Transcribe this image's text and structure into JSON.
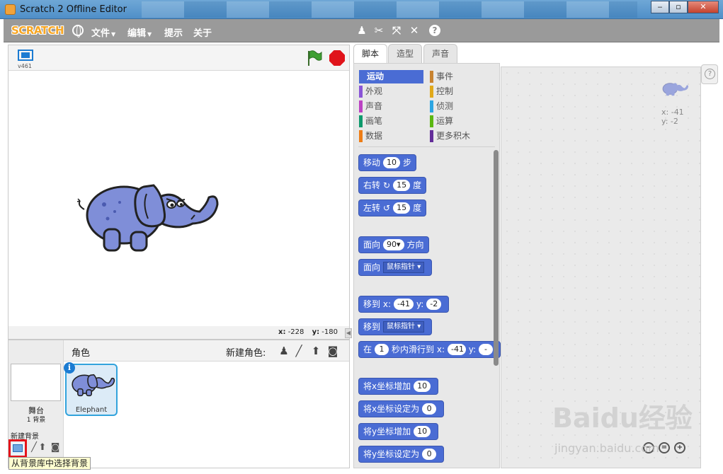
{
  "window": {
    "title": "Scratch 2 Offline Editor",
    "buttons": [
      "‒",
      "▫",
      "✕"
    ]
  },
  "menubar": {
    "logo": "SCRATCH",
    "items": [
      {
        "label": "文件",
        "has_caret": true
      },
      {
        "label": "编辑",
        "has_caret": true
      },
      {
        "label": "提示",
        "has_caret": false
      },
      {
        "label": "关于",
        "has_caret": false
      }
    ],
    "tools": [
      "duplicate-icon",
      "cut-icon",
      "grow-icon",
      "shrink-icon",
      "help-icon"
    ]
  },
  "stage": {
    "version": "v461",
    "coords": {
      "x_label": "x:",
      "x_value": "-228",
      "y_label": "y:",
      "y_value": "-180"
    }
  },
  "sprites": {
    "title": "角色",
    "new_sprite_label": "新建角色:",
    "stage_label": "舞台",
    "backdrop_count": "1 背景",
    "new_backdrop_label": "新建背景",
    "tooltip": "从背景库中选择背景",
    "items": [
      {
        "name": "Elephant",
        "selected": true
      }
    ]
  },
  "tabs": [
    {
      "label": "脚本",
      "active": true
    },
    {
      "label": "造型",
      "active": false
    },
    {
      "label": "声音",
      "active": false
    }
  ],
  "categories": [
    {
      "label": "运动",
      "color": "#4a6cd4",
      "selected": true
    },
    {
      "label": "事件",
      "color": "#c88330",
      "selected": false
    },
    {
      "label": "外观",
      "color": "#8a55d7",
      "selected": false
    },
    {
      "label": "控制",
      "color": "#e1a91a",
      "selected": false
    },
    {
      "label": "声音",
      "color": "#bb42c3",
      "selected": false
    },
    {
      "label": "侦测",
      "color": "#2ca5e2",
      "selected": false
    },
    {
      "label": "画笔",
      "color": "#0e9a6c",
      "selected": false
    },
    {
      "label": "运算",
      "color": "#5cb712",
      "selected": false
    },
    {
      "label": "数据",
      "color": "#ee7d16",
      "selected": false
    },
    {
      "label": "更多积木",
      "color": "#632d99",
      "selected": false
    }
  ],
  "blocks": {
    "move": {
      "label": "移动",
      "value": "10",
      "suffix": "步"
    },
    "turn_right": {
      "label": "右转",
      "value": "15",
      "suffix": "度"
    },
    "turn_left": {
      "label": "左转",
      "value": "15",
      "suffix": "度"
    },
    "point_dir": {
      "label": "面向",
      "value": "90▾",
      "suffix": "方向"
    },
    "point_towards": {
      "label": "面向",
      "dropdown": "鼠标指针"
    },
    "goto_xy": {
      "label": "移到",
      "x_label": "x:",
      "x_value": "-41",
      "y_label": "y:",
      "y_value": "-2"
    },
    "goto": {
      "label": "移到",
      "dropdown": "鼠标指针"
    },
    "glide": {
      "label": "在",
      "secs": "1",
      "mid": "秒内滑行到",
      "x_label": "x:",
      "x_value": "-41",
      "y_label": "y:",
      "y_value": "-"
    },
    "change_x": {
      "label": "将x坐标增加",
      "value": "10"
    },
    "set_x": {
      "label": "将x坐标设定为",
      "value": "0"
    },
    "change_y": {
      "label": "将y坐标增加",
      "value": "10"
    },
    "set_y": {
      "label": "将y坐标设定为",
      "value": "0"
    }
  },
  "script_area": {
    "x_label": "x:",
    "x_value": "-41",
    "y_label": "y:",
    "y_value": "-2"
  },
  "watermark": {
    "main": "Baidu经验",
    "sub": "jingyan.baidu.com"
  }
}
